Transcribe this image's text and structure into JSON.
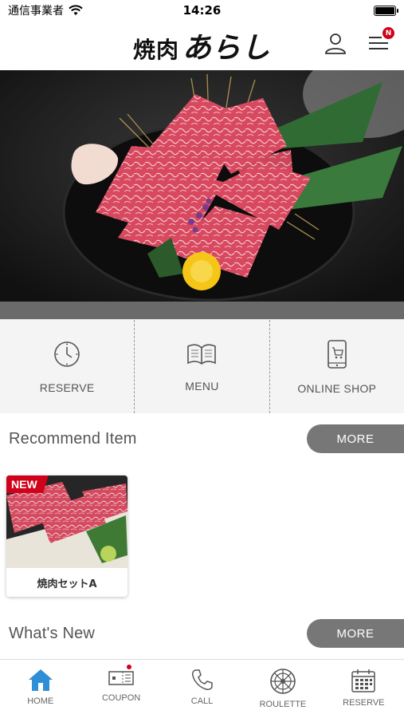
{
  "status_bar": {
    "carrier": "通信事業者",
    "time": "14:26"
  },
  "header": {
    "logo_small": "焼肉",
    "logo_big": "あらし",
    "notification_badge": "N",
    "icons": [
      "user-icon",
      "menu-icon"
    ]
  },
  "quick_nav": [
    {
      "label": "RESERVE",
      "icon": "clock-icon"
    },
    {
      "label": "MENU",
      "icon": "book-icon"
    },
    {
      "label": "ONLINE SHOP",
      "icon": "phone-cart-icon"
    }
  ],
  "recommend": {
    "title": "Recommend Item",
    "more": "MORE",
    "items": [
      {
        "name": "焼肉セットA",
        "badge": "NEW"
      }
    ]
  },
  "whats_new": {
    "title": "What's New",
    "more": "MORE"
  },
  "tab_bar": [
    {
      "label": "HOME",
      "icon": "home-icon",
      "active": true
    },
    {
      "label": "COUPON",
      "icon": "coupon-icon",
      "has_dot": true
    },
    {
      "label": "CALL",
      "icon": "phone-icon"
    },
    {
      "label": "ROULETTE",
      "icon": "roulette-icon"
    },
    {
      "label": "RESERVE",
      "icon": "calendar-icon"
    }
  ],
  "colors": {
    "accent": "#2d8fd6",
    "badge_red": "#d0021b",
    "more_button": "#777777",
    "quick_nav_bg": "#f4f4f4"
  }
}
